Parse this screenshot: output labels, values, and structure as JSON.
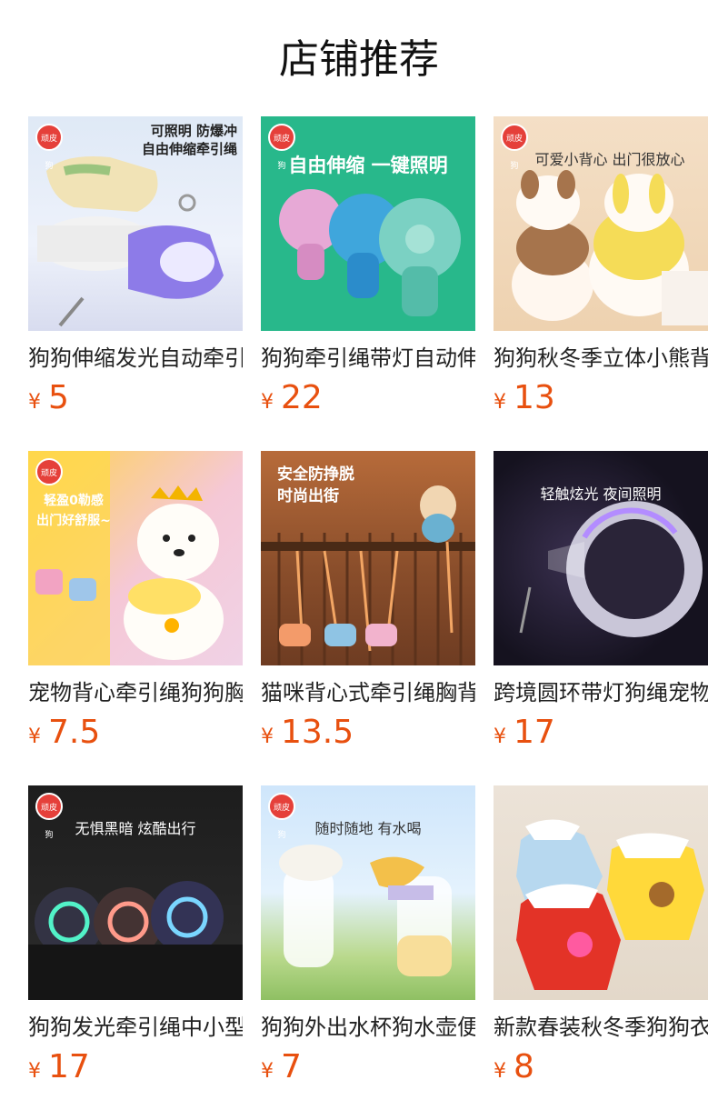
{
  "page": {
    "title": "店铺推荐"
  },
  "badge_text": "顽皮狗",
  "products": [
    {
      "name": "狗狗伸缩发光自动牵引绳",
      "price": "5",
      "banner": "可照明 防爆冲\n自由伸缩牵引绳"
    },
    {
      "name": "狗狗牵引绳带灯自动伸缩",
      "price": "22",
      "banner": "自由伸缩 一键照明"
    },
    {
      "name": "狗狗秋冬季立体小熊背心",
      "price": "13",
      "banner": "可爱小背心 出门很放心"
    },
    {
      "name": "宠物背心牵引绳狗狗胸背",
      "price": "7.5",
      "banner": "轻盈0勒感\n出门好舒服~"
    },
    {
      "name": "猫咪背心式牵引绳胸背带",
      "price": "13.5",
      "banner": "安全防挣脱\n时尚出街"
    },
    {
      "name": "跨境圆环带灯狗绳宠物用品",
      "price": "17",
      "banner": "轻触炫光 夜间照明"
    },
    {
      "name": "狗狗发光牵引绳中小型犬",
      "price": "17",
      "banner": "无惧黑暗 炫酷出行"
    },
    {
      "name": "狗狗外出水杯狗水壶便携",
      "price": "7",
      "banner": "随时随地 有水喝"
    },
    {
      "name": "新款春装秋冬季狗狗衣服",
      "price": "8",
      "banner": ""
    }
  ],
  "currency": "¥"
}
